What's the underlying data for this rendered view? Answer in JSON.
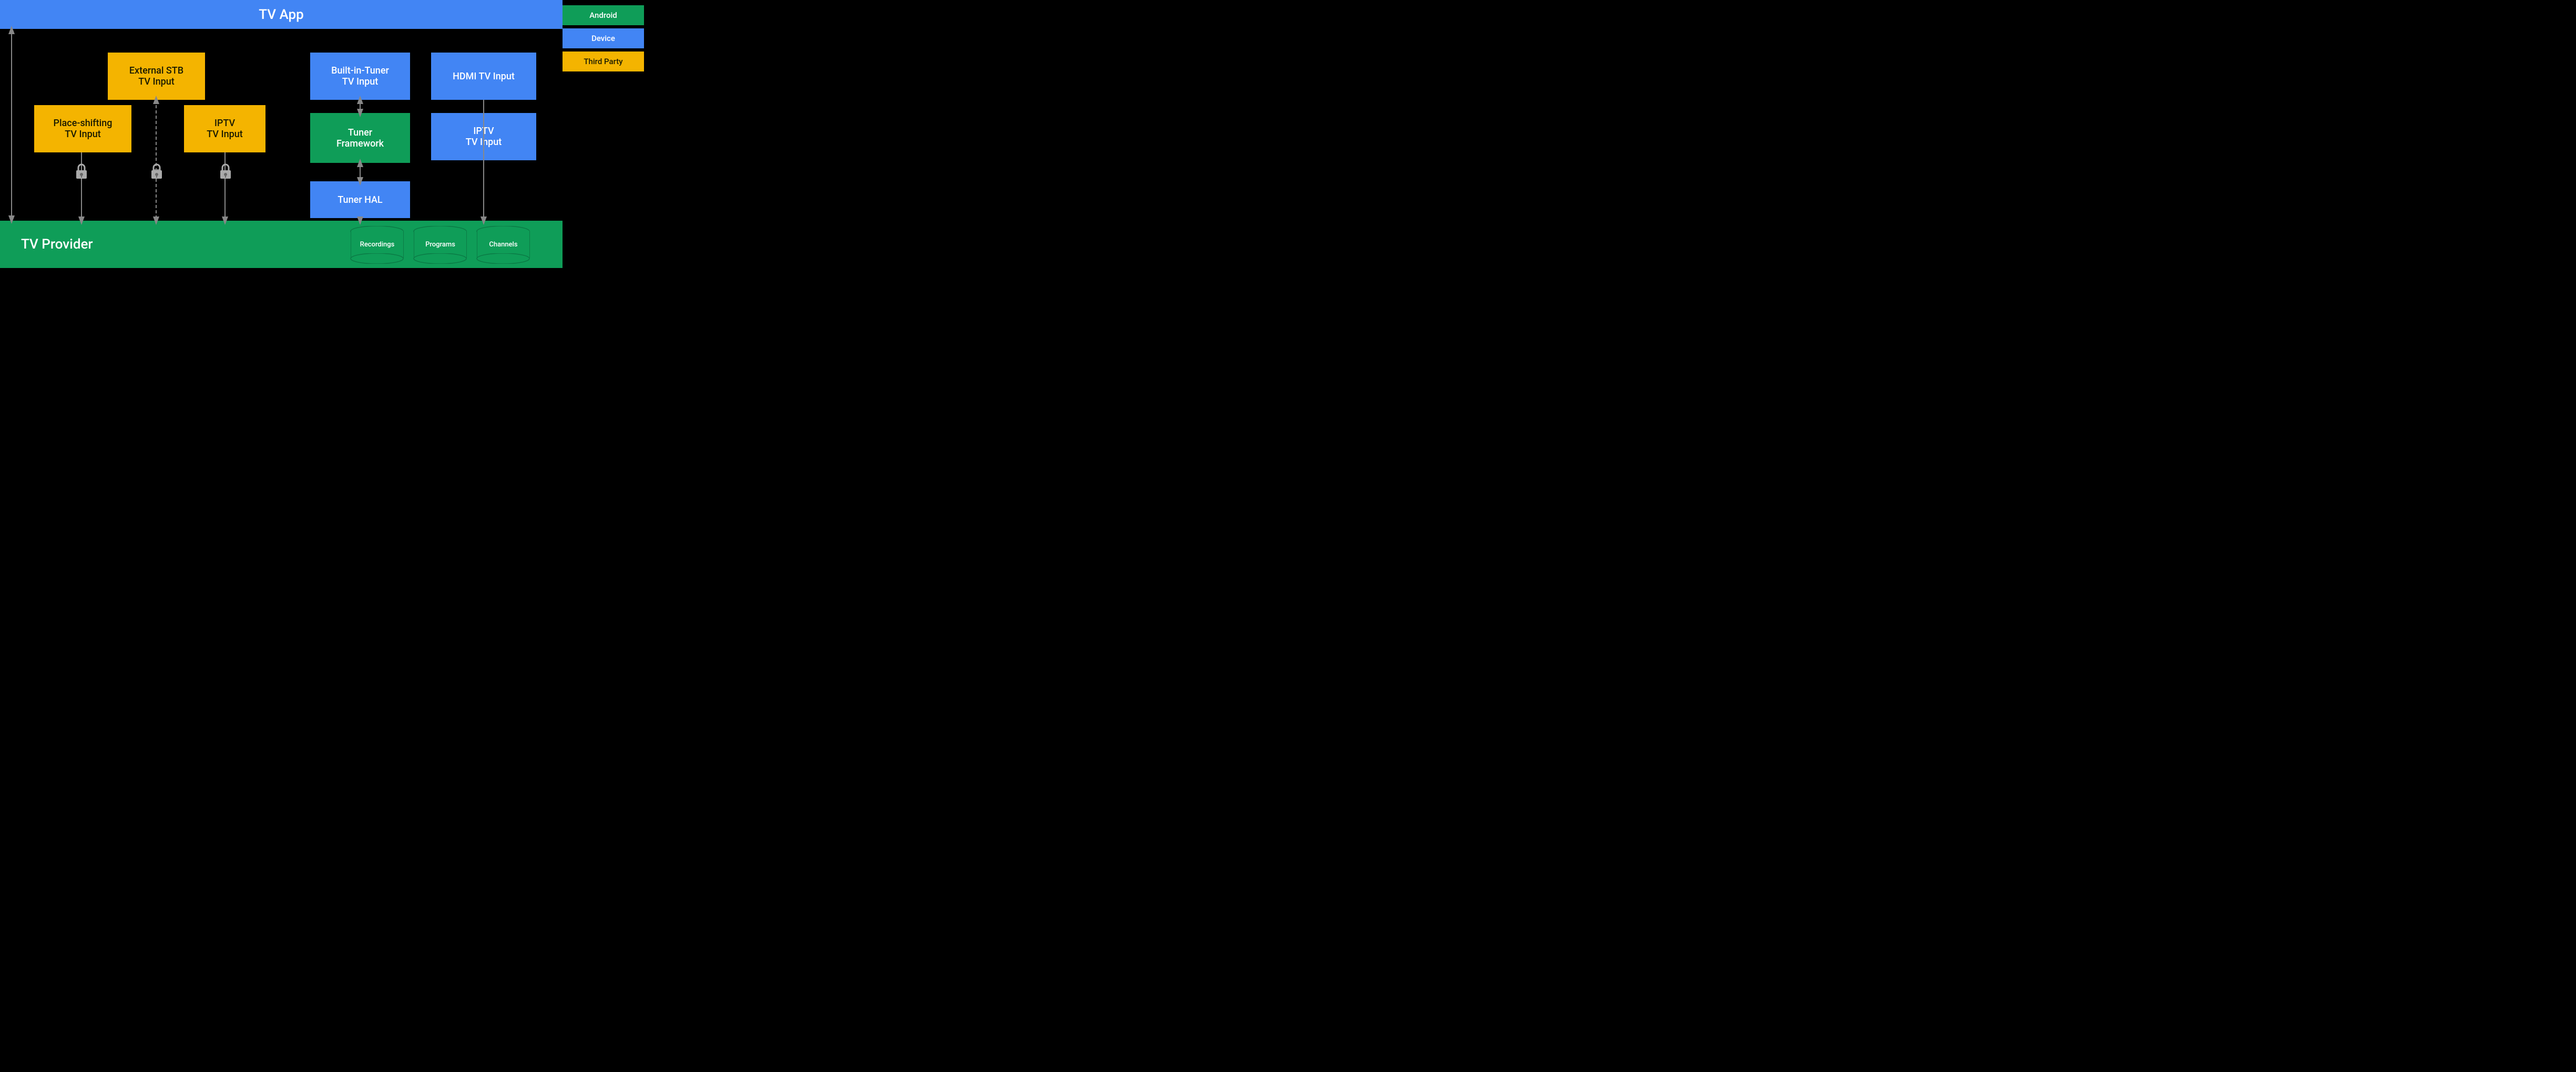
{
  "header": {
    "tv_app_label": "TV App"
  },
  "footer": {
    "tv_provider_label": "TV Provider"
  },
  "legend": {
    "android_label": "Android",
    "device_label": "Device",
    "third_party_label": "Third Party"
  },
  "boxes": {
    "external_stb": "External STB\nTV Input",
    "place_shifting": "Place-shifting\nTV Input",
    "iptv_left": "IPTV\nTV Input",
    "built_in_tuner": "Built-in-Tuner\nTV Input",
    "tuner_framework": "Tuner\nFramework",
    "tuner_hal": "Tuner HAL",
    "hdmi_tv_input": "HDMI TV Input",
    "iptv_right": "IPTV\nTV Input"
  },
  "cylinders": {
    "recordings": "Recordings",
    "programs": "Programs",
    "channels": "Channels"
  },
  "colors": {
    "orange": "#F4B400",
    "blue": "#4285F4",
    "green": "#0F9D58",
    "black": "#000000",
    "white": "#ffffff",
    "arrow": "#888888"
  }
}
